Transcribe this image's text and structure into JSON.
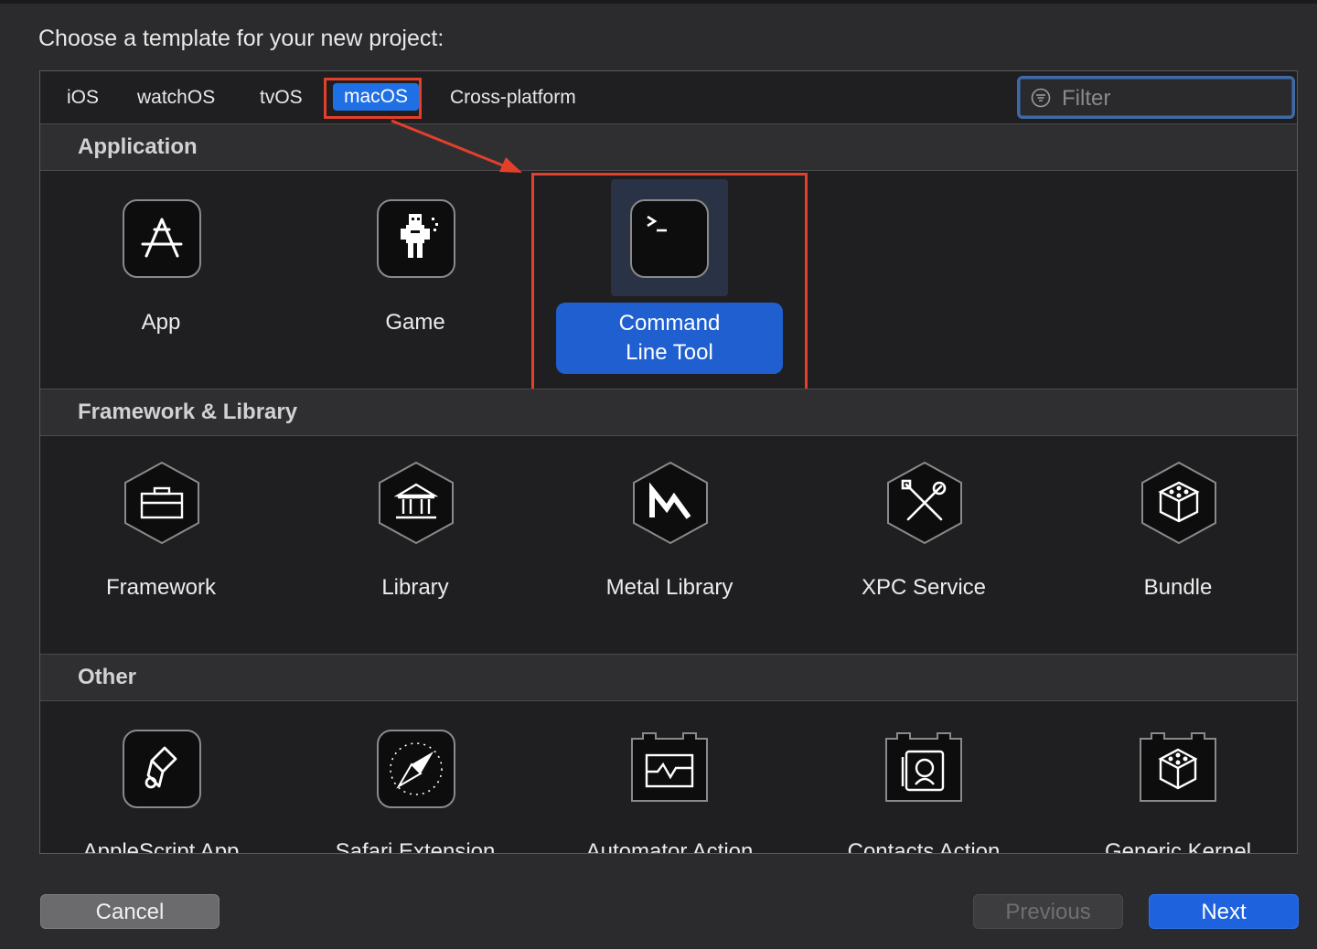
{
  "dialog": {
    "prompt": "Choose a template for your new project:"
  },
  "tabs": [
    {
      "label": "iOS"
    },
    {
      "label": "watchOS"
    },
    {
      "label": "tvOS"
    },
    {
      "label": "macOS",
      "selected": true
    },
    {
      "label": "Cross-platform"
    }
  ],
  "filter": {
    "placeholder": "Filter",
    "icon": "filter-icon"
  },
  "sections": [
    {
      "title": "Application",
      "items": [
        {
          "label": "App",
          "icon": "app-store-icon"
        },
        {
          "label": "Game",
          "icon": "game-robot-icon"
        },
        {
          "label": "Command Line Tool",
          "label_lines": [
            "Command",
            "Line Tool"
          ],
          "icon": "terminal-icon",
          "selected": true
        }
      ]
    },
    {
      "title": "Framework & Library",
      "items": [
        {
          "label": "Framework",
          "icon": "toolbox-icon"
        },
        {
          "label": "Library",
          "icon": "building-icon"
        },
        {
          "label": "Metal Library",
          "icon": "metal-icon"
        },
        {
          "label": "XPC Service",
          "icon": "wrench-screwdriver-icon"
        },
        {
          "label": "Bundle",
          "icon": "cube-icon"
        }
      ]
    },
    {
      "title": "Other",
      "items": [
        {
          "label": "AppleScript App",
          "icon": "scroll-icon"
        },
        {
          "label": "Safari Extension",
          "icon": "compass-icon"
        },
        {
          "label": "Automator Action",
          "icon": "automator-icon"
        },
        {
          "label": "Contacts Action",
          "icon": "contacts-icon"
        },
        {
          "label": "Generic Kernel",
          "icon": "kernel-cube-icon"
        }
      ]
    }
  ],
  "buttons": {
    "cancel": "Cancel",
    "previous": "Previous",
    "next": "Next"
  },
  "colors": {
    "accent": "#1f6fe5",
    "annotation": "#e2402a",
    "background": "#2b2b2d"
  }
}
